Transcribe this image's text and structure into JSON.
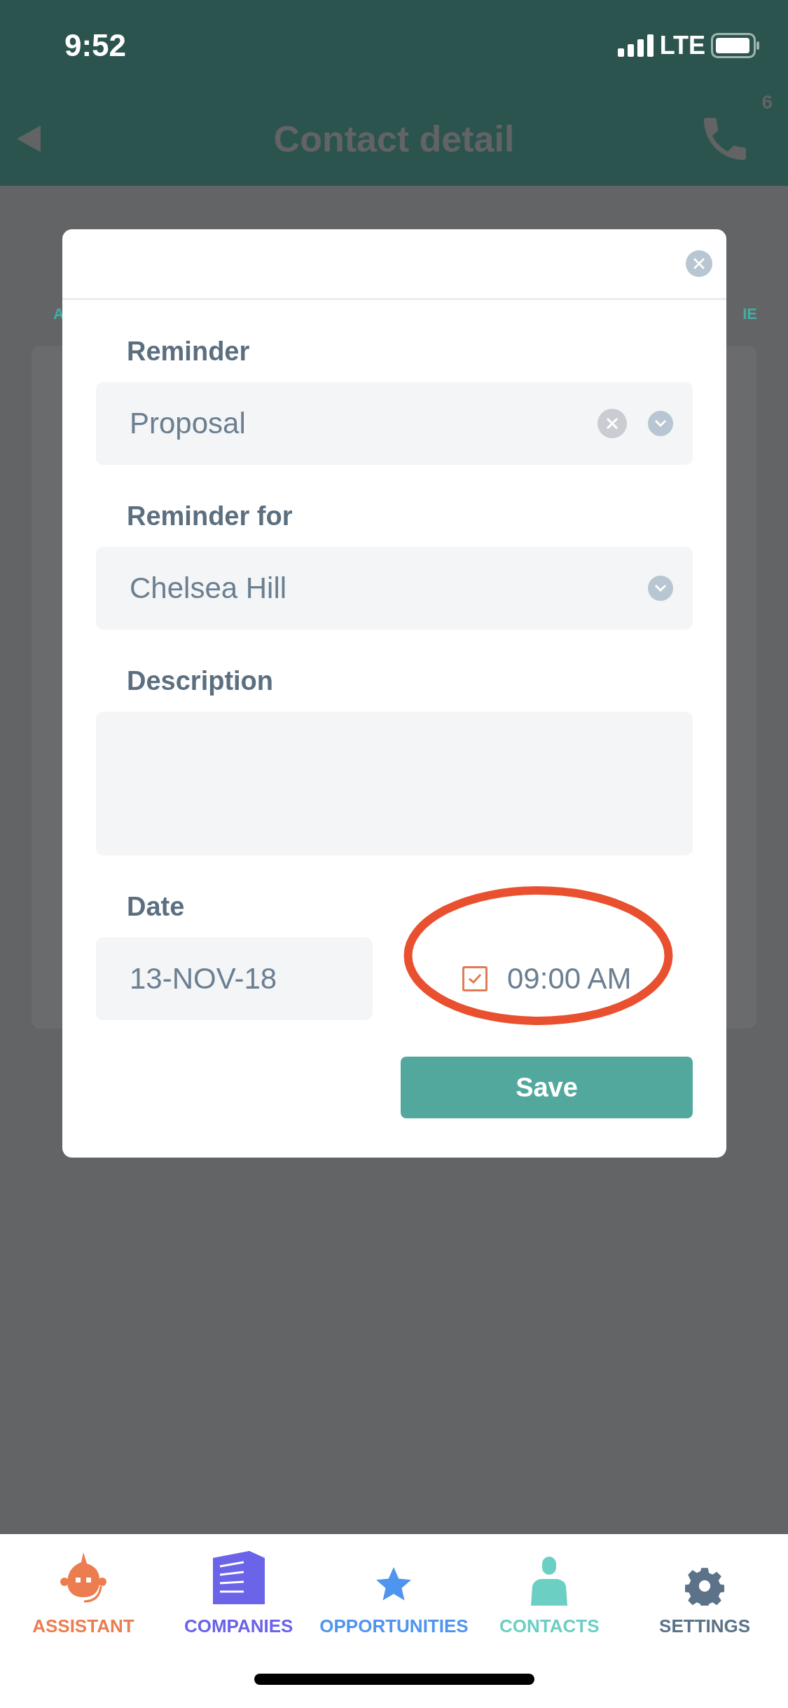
{
  "status_bar": {
    "time": "9:52",
    "network": "LTE"
  },
  "header": {
    "title": "Contact detail",
    "call_badge": "6"
  },
  "background_tabs": {
    "left_label": "A",
    "right_label": "IE"
  },
  "dialog": {
    "fields": [
      {
        "kind": "select",
        "label": "Reminder",
        "value": "Proposal",
        "clearable": true
      },
      {
        "kind": "select",
        "label": "Reminder for",
        "value": "Chelsea Hill",
        "clearable": false
      },
      {
        "kind": "textarea",
        "label": "Description"
      }
    ],
    "date": {
      "label": "Date",
      "value": "13-NOV-18"
    },
    "time": {
      "checked": true,
      "value": "09:00 AM"
    },
    "save_button": "Save"
  },
  "tab_bar": [
    {
      "kind": "assistant",
      "label": "ASSISTANT",
      "color": "#ec7d50"
    },
    {
      "kind": "companies",
      "label": "COMPANIES",
      "color": "#6b63e8"
    },
    {
      "kind": "opportunities",
      "label": "OPPORTUNITIES",
      "color": "#4f94ee"
    },
    {
      "kind": "contacts",
      "label": "CONTACTS",
      "color": "#6ccfc3"
    },
    {
      "kind": "settings",
      "label": "SETTINGS",
      "color": "#5b7288"
    }
  ]
}
